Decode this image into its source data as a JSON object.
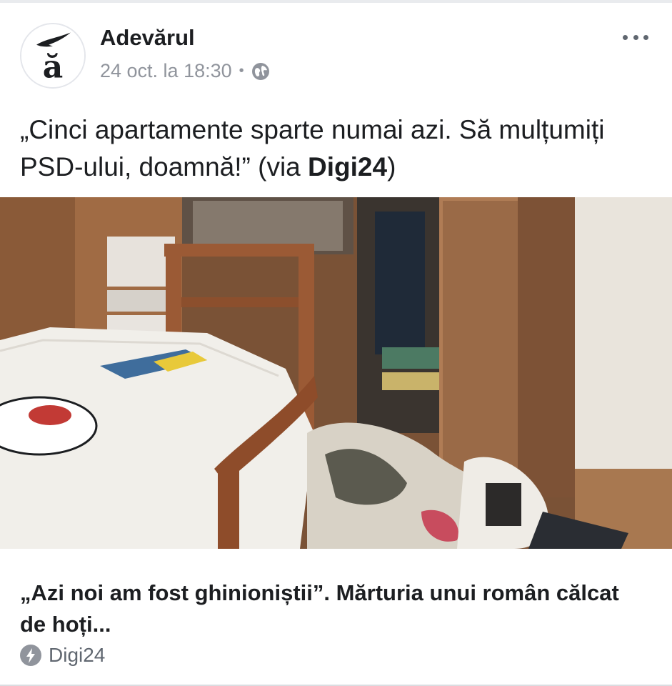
{
  "post": {
    "page_name": "Adevărul",
    "timestamp": "24 oct. la 18:30",
    "separator": "•",
    "privacy_icon": "globe-icon",
    "more_icon": "more-options-icon",
    "avatar_letter": "ă",
    "text_main": "„Cinci apartamente sparte numai azi. Să mulțumiți PSD-ului, doamnă!” (via ",
    "text_bold": "Digi24",
    "text_end": ")"
  },
  "link_preview": {
    "title": "„Azi noi am fost ghinioniștii”. Mărturia unui român călcat de hoți...",
    "source": "Digi24",
    "source_icon": "instant-article-bolt-icon"
  },
  "colors": {
    "text": "#1c1e21",
    "meta": "#90949c",
    "divider": "#dadde1"
  }
}
